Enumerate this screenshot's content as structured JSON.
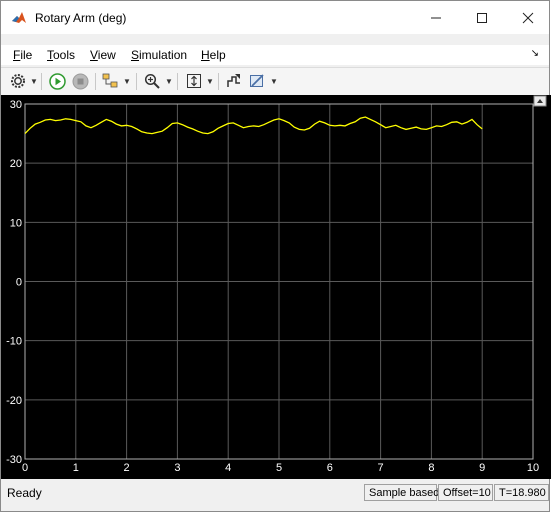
{
  "window": {
    "title": "Rotary Arm (deg)"
  },
  "menu": [
    {
      "label": "File",
      "u": "F",
      "rest": "ile"
    },
    {
      "label": "Tools",
      "u": "T",
      "rest": "ools"
    },
    {
      "label": "View",
      "u": "V",
      "rest": "iew"
    },
    {
      "label": "Simulation",
      "u": "S",
      "rest": "imulation"
    },
    {
      "label": "Help",
      "u": "H",
      "rest": "elp"
    }
  ],
  "toolbar_icons": [
    "settings-icon",
    "run-icon",
    "stop-icon",
    "highlight-block-icon",
    "zoom-in-icon",
    "autoscale-icon",
    "signal-select-icon",
    "style-icon"
  ],
  "status": {
    "ready": "Ready",
    "mode": "Sample based",
    "offset": "Offset=10",
    "time": "T=18.980"
  },
  "colors": {
    "plot_bg": "#000000",
    "grid": "#5a5a5a",
    "signal": "#ffff00",
    "axis_text": "#ffffff"
  },
  "chart_data": {
    "type": "line",
    "x_ticks": [
      0,
      1,
      2,
      3,
      4,
      5,
      6,
      7,
      8,
      9,
      10
    ],
    "y_ticks": [
      -30,
      -20,
      -10,
      0,
      10,
      20,
      30
    ],
    "xlim": [
      0,
      10
    ],
    "ylim": [
      -30,
      30
    ],
    "grid": true,
    "series": [
      {
        "color": "#ffff00",
        "x": [
          0.0,
          0.1,
          0.2,
          0.3,
          0.4,
          0.5,
          0.6,
          0.7,
          0.8,
          0.9,
          1.0,
          1.1,
          1.2,
          1.3,
          1.4,
          1.5,
          1.6,
          1.7,
          1.8,
          1.9,
          2.0,
          2.1,
          2.2,
          2.3,
          2.4,
          2.5,
          2.6,
          2.7,
          2.8,
          2.9,
          3.0,
          3.1,
          3.2,
          3.3,
          3.4,
          3.5,
          3.6,
          3.7,
          3.8,
          3.9,
          4.0,
          4.1,
          4.2,
          4.3,
          4.4,
          4.5,
          4.6,
          4.7,
          4.8,
          4.9,
          5.0,
          5.1,
          5.2,
          5.3,
          5.4,
          5.5,
          5.6,
          5.7,
          5.8,
          5.9,
          6.0,
          6.1,
          6.2,
          6.3,
          6.4,
          6.5,
          6.6,
          6.7,
          6.8,
          6.9,
          7.0,
          7.1,
          7.2,
          7.3,
          7.4,
          7.5,
          7.6,
          7.7,
          7.8,
          7.9,
          8.0,
          8.1,
          8.2,
          8.3,
          8.4,
          8.5,
          8.6,
          8.7,
          8.8,
          8.9,
          9.0
        ],
        "y": [
          25.0,
          25.9,
          26.6,
          26.9,
          27.3,
          27.4,
          27.2,
          27.3,
          27.5,
          27.4,
          27.2,
          27.0,
          26.3,
          26.0,
          26.4,
          26.9,
          27.4,
          27.1,
          26.6,
          26.3,
          26.4,
          26.2,
          25.8,
          25.3,
          25.1,
          25.0,
          25.2,
          25.4,
          26.0,
          26.7,
          26.8,
          26.5,
          26.1,
          25.8,
          25.4,
          25.1,
          25.0,
          25.3,
          25.9,
          26.3,
          26.7,
          26.8,
          26.4,
          26.0,
          26.2,
          26.3,
          26.2,
          26.5,
          26.9,
          27.3,
          27.5,
          27.2,
          26.8,
          26.1,
          25.7,
          25.6,
          25.9,
          26.6,
          27.1,
          26.8,
          26.4,
          26.3,
          26.4,
          26.3,
          26.7,
          27.0,
          27.6,
          27.8,
          27.4,
          27.0,
          26.5,
          26.0,
          26.2,
          26.4,
          26.0,
          25.7,
          25.9,
          26.1,
          25.8,
          25.7,
          26.0,
          26.3,
          26.2,
          26.5,
          26.9,
          27.0,
          26.6,
          26.9,
          27.4,
          26.5,
          25.8
        ]
      }
    ]
  }
}
